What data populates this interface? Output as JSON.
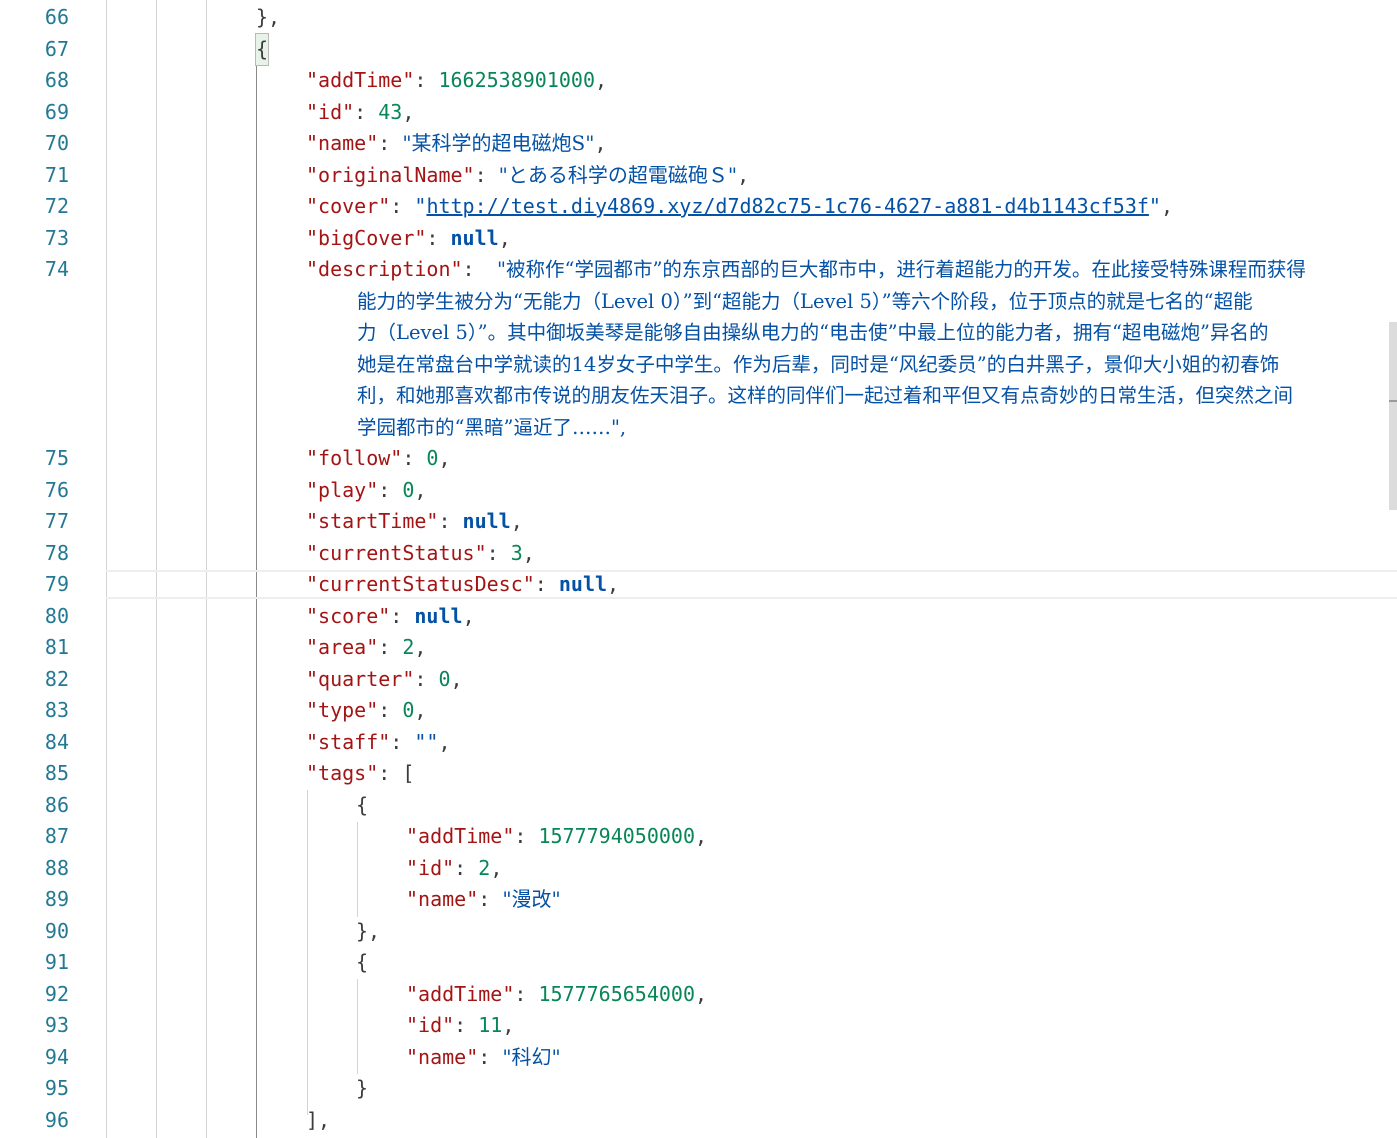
{
  "lines": [
    {
      "n": "66",
      "indent": 1,
      "tokens": [
        [
          "punc",
          "},"
        ]
      ]
    },
    {
      "n": "67",
      "indent": 1,
      "tokens": [
        [
          "brace",
          "{"
        ]
      ]
    },
    {
      "n": "68",
      "indent": 2,
      "tokens": [
        [
          "key",
          "\"addTime\""
        ],
        [
          "punc",
          ": "
        ],
        [
          "num",
          "1662538901000"
        ],
        [
          "punc",
          ","
        ]
      ]
    },
    {
      "n": "69",
      "indent": 2,
      "tokens": [
        [
          "key",
          "\"id\""
        ],
        [
          "punc",
          ": "
        ],
        [
          "num",
          "43"
        ],
        [
          "punc",
          ","
        ]
      ]
    },
    {
      "n": "70",
      "indent": 2,
      "tokens": [
        [
          "key",
          "\"name\""
        ],
        [
          "punc",
          ": "
        ],
        [
          "str",
          "\"某科学的超电磁炮S\""
        ],
        [
          "punc",
          ","
        ]
      ]
    },
    {
      "n": "71",
      "indent": 2,
      "tokens": [
        [
          "key",
          "\"originalName\""
        ],
        [
          "punc",
          ": "
        ],
        [
          "str",
          "\"とある科学の超電磁砲Ｓ\""
        ],
        [
          "punc",
          ","
        ]
      ]
    },
    {
      "n": "72",
      "indent": 2,
      "tokens": [
        [
          "key",
          "\"cover\""
        ],
        [
          "punc",
          ": "
        ],
        [
          "str",
          "\""
        ],
        [
          "link",
          "http://test.diy4869.xyz/d7d82c75-1c76-4627-a881-d4b1143cf53f"
        ],
        [
          "str",
          "\""
        ],
        [
          "punc",
          ","
        ]
      ]
    },
    {
      "n": "73",
      "indent": 2,
      "tokens": [
        [
          "key",
          "\"bigCover\""
        ],
        [
          "punc",
          ": "
        ],
        [
          "kw",
          "null"
        ],
        [
          "punc",
          ","
        ]
      ]
    },
    {
      "n": "74",
      "indent": 2,
      "tokens": [
        [
          "key",
          "\"description\""
        ],
        [
          "punc",
          ": "
        ]
      ],
      "desc": true
    },
    {
      "n": "75",
      "indent": 2,
      "tokens": [
        [
          "key",
          "\"follow\""
        ],
        [
          "punc",
          ": "
        ],
        [
          "num",
          "0"
        ],
        [
          "punc",
          ","
        ]
      ]
    },
    {
      "n": "76",
      "indent": 2,
      "tokens": [
        [
          "key",
          "\"play\""
        ],
        [
          "punc",
          ": "
        ],
        [
          "num",
          "0"
        ],
        [
          "punc",
          ","
        ]
      ]
    },
    {
      "n": "77",
      "indent": 2,
      "tokens": [
        [
          "key",
          "\"startTime\""
        ],
        [
          "punc",
          ": "
        ],
        [
          "kw",
          "null"
        ],
        [
          "punc",
          ","
        ]
      ]
    },
    {
      "n": "78",
      "indent": 2,
      "tokens": [
        [
          "key",
          "\"currentStatus\""
        ],
        [
          "punc",
          ": "
        ],
        [
          "num",
          "3"
        ],
        [
          "punc",
          ","
        ]
      ]
    },
    {
      "n": "79",
      "indent": 2,
      "tokens": [
        [
          "key",
          "\"currentStatusDesc\""
        ],
        [
          "punc",
          ": "
        ],
        [
          "kw",
          "null"
        ],
        [
          "punc",
          ","
        ]
      ]
    },
    {
      "n": "80",
      "indent": 2,
      "tokens": [
        [
          "key",
          "\"score\""
        ],
        [
          "punc",
          ": "
        ],
        [
          "kw",
          "null"
        ],
        [
          "punc",
          ","
        ]
      ]
    },
    {
      "n": "81",
      "indent": 2,
      "tokens": [
        [
          "key",
          "\"area\""
        ],
        [
          "punc",
          ": "
        ],
        [
          "num",
          "2"
        ],
        [
          "punc",
          ","
        ]
      ]
    },
    {
      "n": "82",
      "indent": 2,
      "tokens": [
        [
          "key",
          "\"quarter\""
        ],
        [
          "punc",
          ": "
        ],
        [
          "num",
          "0"
        ],
        [
          "punc",
          ","
        ]
      ]
    },
    {
      "n": "83",
      "indent": 2,
      "tokens": [
        [
          "key",
          "\"type\""
        ],
        [
          "punc",
          ": "
        ],
        [
          "num",
          "0"
        ],
        [
          "punc",
          ","
        ]
      ]
    },
    {
      "n": "84",
      "indent": 2,
      "tokens": [
        [
          "key",
          "\"staff\""
        ],
        [
          "punc",
          ": "
        ],
        [
          "str",
          "\"\""
        ],
        [
          "punc",
          ","
        ]
      ]
    },
    {
      "n": "85",
      "indent": 2,
      "tokens": [
        [
          "key",
          "\"tags\""
        ],
        [
          "punc",
          ": "
        ],
        [
          "punc",
          "["
        ]
      ]
    },
    {
      "n": "86",
      "indent": 3,
      "tokens": [
        [
          "punc",
          "{"
        ]
      ]
    },
    {
      "n": "87",
      "indent": 4,
      "tokens": [
        [
          "key",
          "\"addTime\""
        ],
        [
          "punc",
          ": "
        ],
        [
          "num",
          "1577794050000"
        ],
        [
          "punc",
          ","
        ]
      ]
    },
    {
      "n": "88",
      "indent": 4,
      "tokens": [
        [
          "key",
          "\"id\""
        ],
        [
          "punc",
          ": "
        ],
        [
          "num",
          "2"
        ],
        [
          "punc",
          ","
        ]
      ]
    },
    {
      "n": "89",
      "indent": 4,
      "tokens": [
        [
          "key",
          "\"name\""
        ],
        [
          "punc",
          ": "
        ],
        [
          "str",
          "\"漫改\""
        ]
      ]
    },
    {
      "n": "90",
      "indent": 3,
      "tokens": [
        [
          "punc",
          "},"
        ]
      ]
    },
    {
      "n": "91",
      "indent": 3,
      "tokens": [
        [
          "punc",
          "{"
        ]
      ]
    },
    {
      "n": "92",
      "indent": 4,
      "tokens": [
        [
          "key",
          "\"addTime\""
        ],
        [
          "punc",
          ": "
        ],
        [
          "num",
          "1577765654000"
        ],
        [
          "punc",
          ","
        ]
      ]
    },
    {
      "n": "93",
      "indent": 4,
      "tokens": [
        [
          "key",
          "\"id\""
        ],
        [
          "punc",
          ": "
        ],
        [
          "num",
          "11"
        ],
        [
          "punc",
          ","
        ]
      ]
    },
    {
      "n": "94",
      "indent": 4,
      "tokens": [
        [
          "key",
          "\"name\""
        ],
        [
          "punc",
          ": "
        ],
        [
          "str",
          "\"科幻\""
        ]
      ]
    },
    {
      "n": "95",
      "indent": 3,
      "tokens": [
        [
          "punc",
          "}"
        ]
      ]
    },
    {
      "n": "96",
      "indent": 2,
      "tokens": [
        [
          "punc",
          "],"
        ]
      ]
    }
  ],
  "description_lines": [
    "\"被称作“学园都市”的东京西部的巨大都市中，进行着超能力的开发。在此接受特殊课程而获得",
    "能力的学生被分为“无能力（Level 0）”到“超能力（Level 5）”等六个阶段，位于顶点的就是七名的“超能",
    "力（Level 5）”。其中御坂美琴是能够自由操纵电力的“电击使”中最上位的能力者，拥有“超电磁炮”异名的",
    "她是在常盘台中学就读的14岁女子中学生。作为后辈，同时是“风纪委员”的白井黑子，景仰大小姐的初春饰",
    "利，和她那喜欢都市传说的朋友佐天泪子。这样的同伴们一起过着和平但又有点奇妙的日常生活，但突然之间",
    "学园都市的“黑暗”逼近了……\","
  ]
}
